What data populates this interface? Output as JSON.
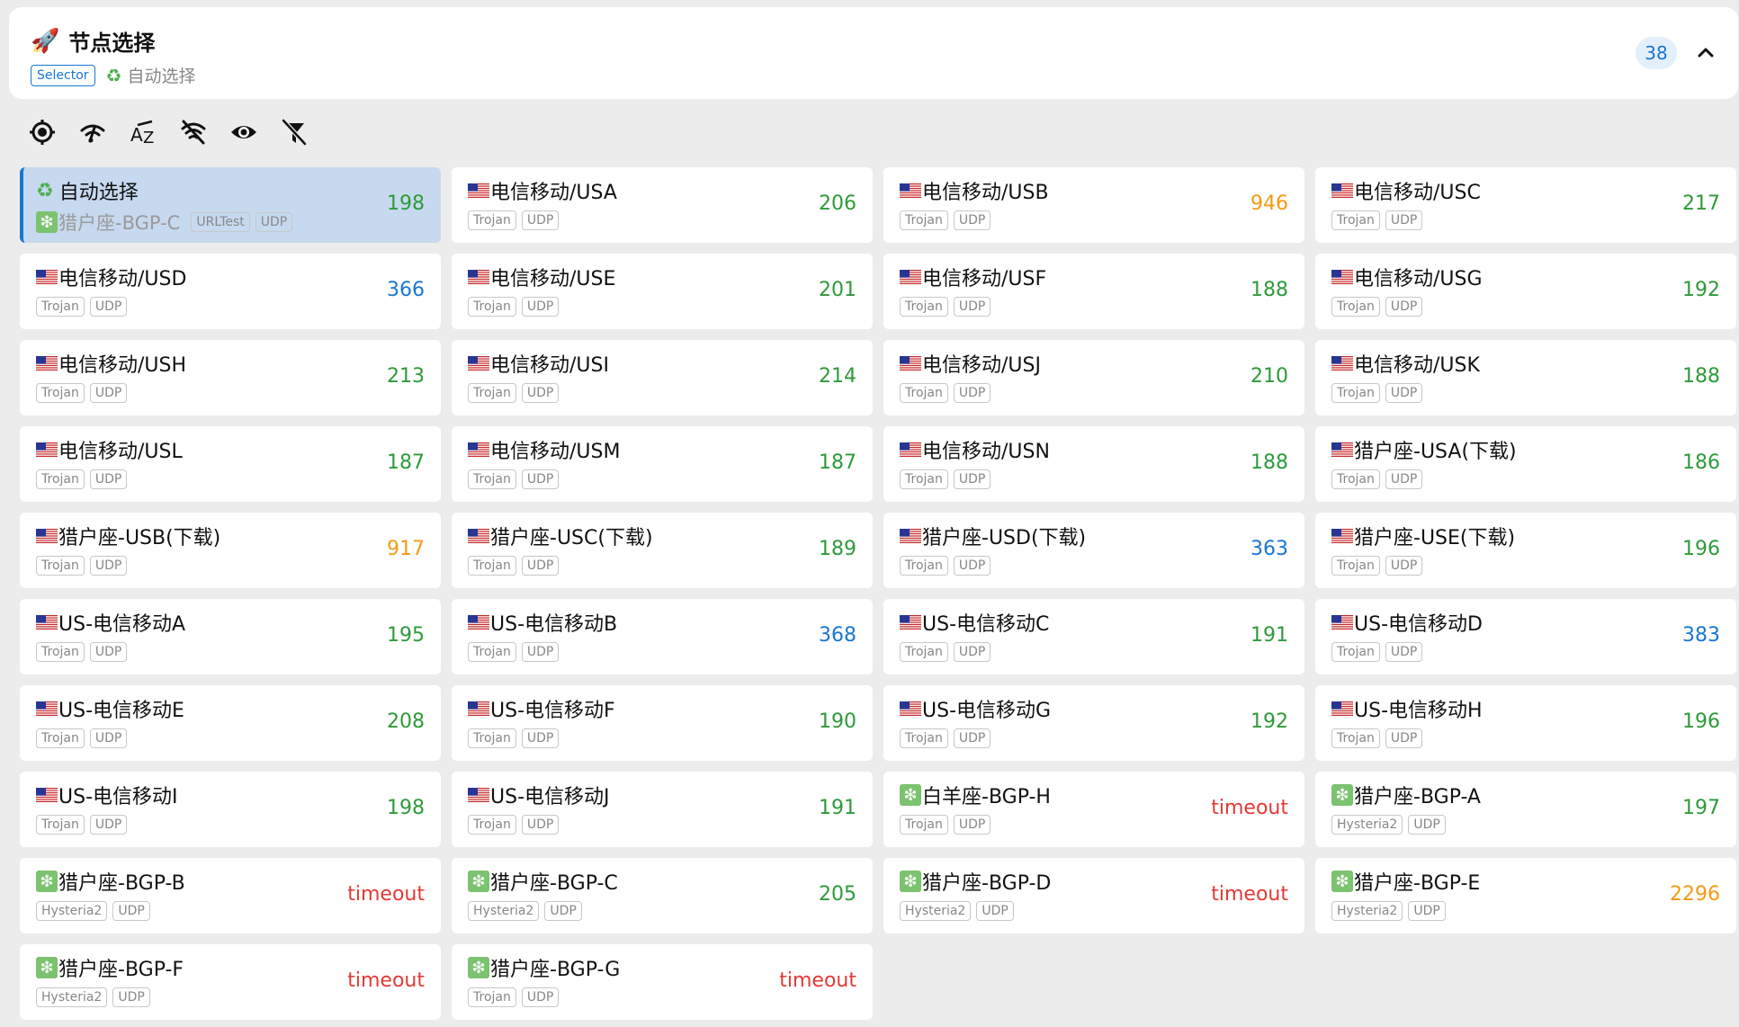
{
  "header": {
    "icon": "rocket-icon",
    "title": "节点选择",
    "type_badge": "Selector",
    "current_node": "自动选择",
    "count": "38"
  },
  "toolbar": [
    "locate-icon",
    "delay-test-icon",
    "sort-az-icon",
    "hide-unavailable-icon",
    "show-icon",
    "filter-off-icon"
  ],
  "colors": {
    "accent": "#1976d2",
    "good": "#2e9a3a",
    "medium": "#f39c12",
    "fair": "#1976d2",
    "bad": "#e53935"
  },
  "selected_node": {
    "name": "自动选择",
    "sub": "猎户座-BGP-C",
    "tags": [
      "URLTest",
      "UDP"
    ],
    "delay": "198",
    "delay_color": "green"
  },
  "nodes": [
    {
      "icon": "us",
      "name": "电信移动/USA",
      "tags": [
        "Trojan",
        "UDP"
      ],
      "delay": "206",
      "delay_color": "green"
    },
    {
      "icon": "us",
      "name": "电信移动/USB",
      "tags": [
        "Trojan",
        "UDP"
      ],
      "delay": "946",
      "delay_color": "orange"
    },
    {
      "icon": "us",
      "name": "电信移动/USC",
      "tags": [
        "Trojan",
        "UDP"
      ],
      "delay": "217",
      "delay_color": "green"
    },
    {
      "icon": "us",
      "name": "电信移动/USD",
      "tags": [
        "Trojan",
        "UDP"
      ],
      "delay": "366",
      "delay_color": "blue"
    },
    {
      "icon": "us",
      "name": "电信移动/USE",
      "tags": [
        "Trojan",
        "UDP"
      ],
      "delay": "201",
      "delay_color": "green"
    },
    {
      "icon": "us",
      "name": "电信移动/USF",
      "tags": [
        "Trojan",
        "UDP"
      ],
      "delay": "188",
      "delay_color": "green"
    },
    {
      "icon": "us",
      "name": "电信移动/USG",
      "tags": [
        "Trojan",
        "UDP"
      ],
      "delay": "192",
      "delay_color": "green"
    },
    {
      "icon": "us",
      "name": "电信移动/USH",
      "tags": [
        "Trojan",
        "UDP"
      ],
      "delay": "213",
      "delay_color": "green"
    },
    {
      "icon": "us",
      "name": "电信移动/USI",
      "tags": [
        "Trojan",
        "UDP"
      ],
      "delay": "214",
      "delay_color": "green"
    },
    {
      "icon": "us",
      "name": "电信移动/USJ",
      "tags": [
        "Trojan",
        "UDP"
      ],
      "delay": "210",
      "delay_color": "green"
    },
    {
      "icon": "us",
      "name": "电信移动/USK",
      "tags": [
        "Trojan",
        "UDP"
      ],
      "delay": "188",
      "delay_color": "green"
    },
    {
      "icon": "us",
      "name": "电信移动/USL",
      "tags": [
        "Trojan",
        "UDP"
      ],
      "delay": "187",
      "delay_color": "green"
    },
    {
      "icon": "us",
      "name": "电信移动/USM",
      "tags": [
        "Trojan",
        "UDP"
      ],
      "delay": "187",
      "delay_color": "green"
    },
    {
      "icon": "us",
      "name": "电信移动/USN",
      "tags": [
        "Trojan",
        "UDP"
      ],
      "delay": "188",
      "delay_color": "green"
    },
    {
      "icon": "us",
      "name": "猎户座-USA(下载)",
      "tags": [
        "Trojan",
        "UDP"
      ],
      "delay": "186",
      "delay_color": "green"
    },
    {
      "icon": "us",
      "name": "猎户座-USB(下载)",
      "tags": [
        "Trojan",
        "UDP"
      ],
      "delay": "917",
      "delay_color": "orange"
    },
    {
      "icon": "us",
      "name": "猎户座-USC(下载)",
      "tags": [
        "Trojan",
        "UDP"
      ],
      "delay": "189",
      "delay_color": "green"
    },
    {
      "icon": "us",
      "name": "猎户座-USD(下载)",
      "tags": [
        "Trojan",
        "UDP"
      ],
      "delay": "363",
      "delay_color": "blue"
    },
    {
      "icon": "us",
      "name": "猎户座-USE(下载)",
      "tags": [
        "Trojan",
        "UDP"
      ],
      "delay": "196",
      "delay_color": "green"
    },
    {
      "icon": "us",
      "name": "US-电信移动A",
      "tags": [
        "Trojan",
        "UDP"
      ],
      "delay": "195",
      "delay_color": "green"
    },
    {
      "icon": "us",
      "name": "US-电信移动B",
      "tags": [
        "Trojan",
        "UDP"
      ],
      "delay": "368",
      "delay_color": "blue"
    },
    {
      "icon": "us",
      "name": "US-电信移动C",
      "tags": [
        "Trojan",
        "UDP"
      ],
      "delay": "191",
      "delay_color": "green"
    },
    {
      "icon": "us",
      "name": "US-电信移动D",
      "tags": [
        "Trojan",
        "UDP"
      ],
      "delay": "383",
      "delay_color": "blue"
    },
    {
      "icon": "us",
      "name": "US-电信移动E",
      "tags": [
        "Trojan",
        "UDP"
      ],
      "delay": "208",
      "delay_color": "green"
    },
    {
      "icon": "us",
      "name": "US-电信移动F",
      "tags": [
        "Trojan",
        "UDP"
      ],
      "delay": "190",
      "delay_color": "green"
    },
    {
      "icon": "us",
      "name": "US-电信移动G",
      "tags": [
        "Trojan",
        "UDP"
      ],
      "delay": "192",
      "delay_color": "green"
    },
    {
      "icon": "us",
      "name": "US-电信移动H",
      "tags": [
        "Trojan",
        "UDP"
      ],
      "delay": "196",
      "delay_color": "green"
    },
    {
      "icon": "us",
      "name": "US-电信移动I",
      "tags": [
        "Trojan",
        "UDP"
      ],
      "delay": "198",
      "delay_color": "green"
    },
    {
      "icon": "us",
      "name": "US-电信移动J",
      "tags": [
        "Trojan",
        "UDP"
      ],
      "delay": "191",
      "delay_color": "green"
    },
    {
      "icon": "sparkle",
      "name": "白羊座-BGP-H",
      "tags": [
        "Trojan",
        "UDP"
      ],
      "delay": "timeout",
      "delay_color": "red"
    },
    {
      "icon": "sparkle",
      "name": "猎户座-BGP-A",
      "tags": [
        "Hysteria2",
        "UDP"
      ],
      "delay": "197",
      "delay_color": "green"
    },
    {
      "icon": "sparkle",
      "name": "猎户座-BGP-B",
      "tags": [
        "Hysteria2",
        "UDP"
      ],
      "delay": "timeout",
      "delay_color": "red"
    },
    {
      "icon": "sparkle",
      "name": "猎户座-BGP-C",
      "tags": [
        "Hysteria2",
        "UDP"
      ],
      "delay": "205",
      "delay_color": "green"
    },
    {
      "icon": "sparkle",
      "name": "猎户座-BGP-D",
      "tags": [
        "Hysteria2",
        "UDP"
      ],
      "delay": "timeout",
      "delay_color": "red"
    },
    {
      "icon": "sparkle",
      "name": "猎户座-BGP-E",
      "tags": [
        "Hysteria2",
        "UDP"
      ],
      "delay": "2296",
      "delay_color": "orange"
    },
    {
      "icon": "sparkle",
      "name": "猎户座-BGP-F",
      "tags": [
        "Hysteria2",
        "UDP"
      ],
      "delay": "timeout",
      "delay_color": "red"
    },
    {
      "icon": "sparkle",
      "name": "猎户座-BGP-G",
      "tags": [
        "Trojan",
        "UDP"
      ],
      "delay": "timeout",
      "delay_color": "red"
    }
  ]
}
